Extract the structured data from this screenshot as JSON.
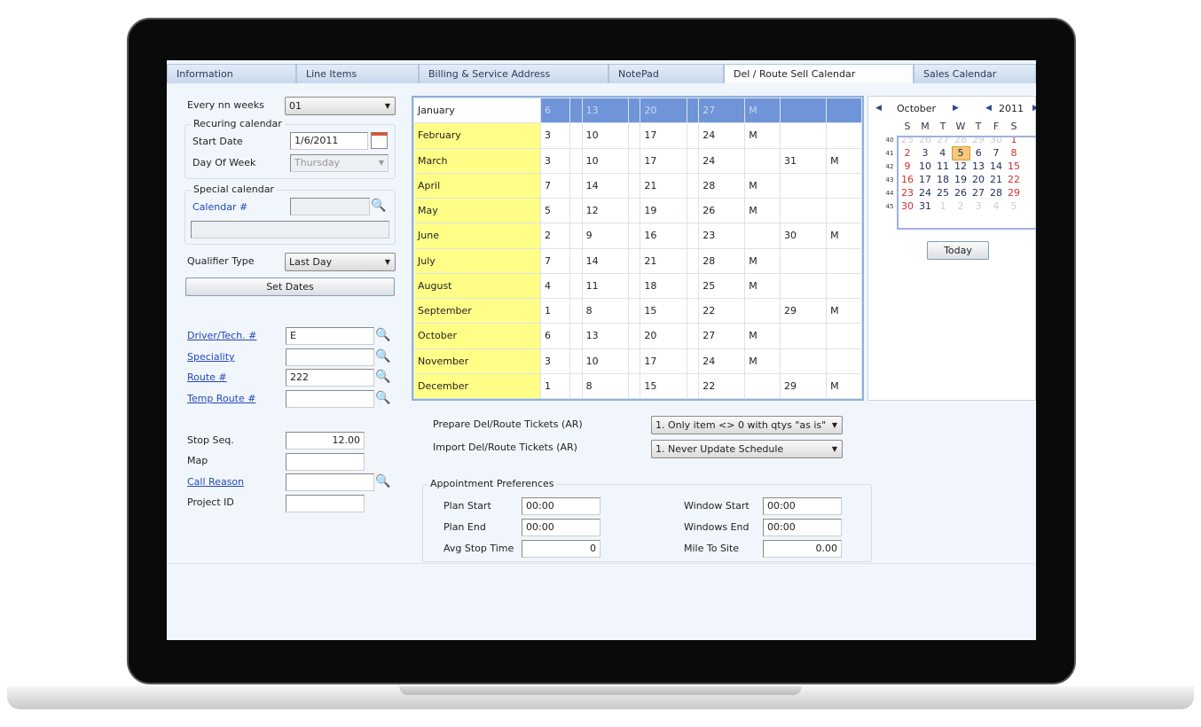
{
  "tabs": [
    {
      "label": "Information"
    },
    {
      "label": "Line Items"
    },
    {
      "label": "Billing & Service Address"
    },
    {
      "label": "NotePad"
    },
    {
      "label": "Del / Route Sell Calendar",
      "active": true
    },
    {
      "label": "Sales Calendar"
    }
  ],
  "form": {
    "every_nn_weeks_label": "Every nn weeks",
    "every_nn_weeks_value": "01",
    "recurring_title": "Recuring calendar",
    "start_date_label": "Start Date",
    "start_date_value": "1/6/2011",
    "day_of_week_label": "Day Of Week",
    "day_of_week_value": "Thursday",
    "special_title": "Special calendar",
    "calendar_label": "Calendar #",
    "calendar_value": "",
    "calendar_desc": "",
    "qualifier_label": "Qualifier Type",
    "qualifier_value": "Last Day",
    "set_dates": "Set Dates",
    "driver_label": "Driver/Tech. #",
    "driver_value": "E",
    "speciality_label": "Speciality",
    "speciality_value": "",
    "route_label": "Route #",
    "route_value": "222",
    "temp_route_label": "Temp Route #",
    "temp_route_value": "",
    "stop_seq_label": "Stop Seq.",
    "stop_seq_value": "12.00",
    "map_label": "Map",
    "map_value": "",
    "call_reason_label": "Call Reason",
    "call_reason_value": "",
    "project_label": "Project ID",
    "project_value": ""
  },
  "schedule": [
    [
      "January",
      "6",
      "",
      "13",
      "",
      "20",
      "",
      "27",
      "M",
      "",
      ""
    ],
    [
      "February",
      "3",
      "",
      "10",
      "",
      "17",
      "",
      "24",
      "M",
      "",
      ""
    ],
    [
      "March",
      "3",
      "",
      "10",
      "",
      "17",
      "",
      "24",
      "",
      "31",
      "M"
    ],
    [
      "April",
      "7",
      "",
      "14",
      "",
      "21",
      "",
      "28",
      "M",
      "",
      ""
    ],
    [
      "May",
      "5",
      "",
      "12",
      "",
      "19",
      "",
      "26",
      "M",
      "",
      ""
    ],
    [
      "June",
      "2",
      "",
      "9",
      "",
      "16",
      "",
      "23",
      "",
      "30",
      "M"
    ],
    [
      "July",
      "7",
      "",
      "14",
      "",
      "21",
      "",
      "28",
      "M",
      "",
      ""
    ],
    [
      "August",
      "4",
      "",
      "11",
      "",
      "18",
      "",
      "25",
      "M",
      "",
      ""
    ],
    [
      "September",
      "1",
      "",
      "8",
      "",
      "15",
      "",
      "22",
      "",
      "29",
      "M"
    ],
    [
      "October",
      "6",
      "",
      "13",
      "",
      "20",
      "",
      "27",
      "M",
      "",
      ""
    ],
    [
      "November",
      "3",
      "",
      "10",
      "",
      "17",
      "",
      "24",
      "M",
      "",
      ""
    ],
    [
      "December",
      "1",
      "",
      "8",
      "",
      "15",
      "",
      "22",
      "",
      "29",
      "M"
    ]
  ],
  "mini_calendar": {
    "month": "October",
    "year": "2011",
    "days": [
      "S",
      "M",
      "T",
      "W",
      "T",
      "F",
      "S"
    ],
    "weeks": [
      {
        "wk": "40",
        "d": [
          "25",
          "26",
          "27",
          "28",
          "29",
          "30",
          "1"
        ]
      },
      {
        "wk": "41",
        "d": [
          "2",
          "3",
          "4",
          "5",
          "6",
          "7",
          "8"
        ]
      },
      {
        "wk": "42",
        "d": [
          "9",
          "10",
          "11",
          "12",
          "13",
          "14",
          "15"
        ]
      },
      {
        "wk": "43",
        "d": [
          "16",
          "17",
          "18",
          "19",
          "20",
          "21",
          "22"
        ]
      },
      {
        "wk": "44",
        "d": [
          "23",
          "24",
          "25",
          "26",
          "27",
          "28",
          "29"
        ]
      },
      {
        "wk": "45",
        "d": [
          "30",
          "31",
          "1",
          "2",
          "3",
          "4",
          "5"
        ]
      }
    ],
    "selected": "5",
    "today_label": "Today"
  },
  "tickets": {
    "prepare_label": "Prepare Del/Route Tickets (AR)",
    "prepare_value": "1. Only item <> 0 with qtys \"as is\"",
    "import_label": "Import Del/Route Tickets (AR)",
    "import_value": "1. Never Update Schedule"
  },
  "appointment": {
    "title": "Appointment Preferences",
    "plan_start_label": "Plan Start",
    "plan_start": "00:00",
    "plan_end_label": "Plan End",
    "plan_end": "00:00",
    "avg_stop_label": "Avg Stop Time",
    "avg_stop": "0",
    "window_start_label": "Window Start",
    "window_start": "00:00",
    "windows_end_label": "Windows End",
    "windows_end": "00:00",
    "mile_label": "Mile To Site",
    "mile": "0.00"
  },
  "colors": {
    "highlight_row": "#6f95d8",
    "month_cell": "#ffff88",
    "weekend": "#d03030"
  }
}
